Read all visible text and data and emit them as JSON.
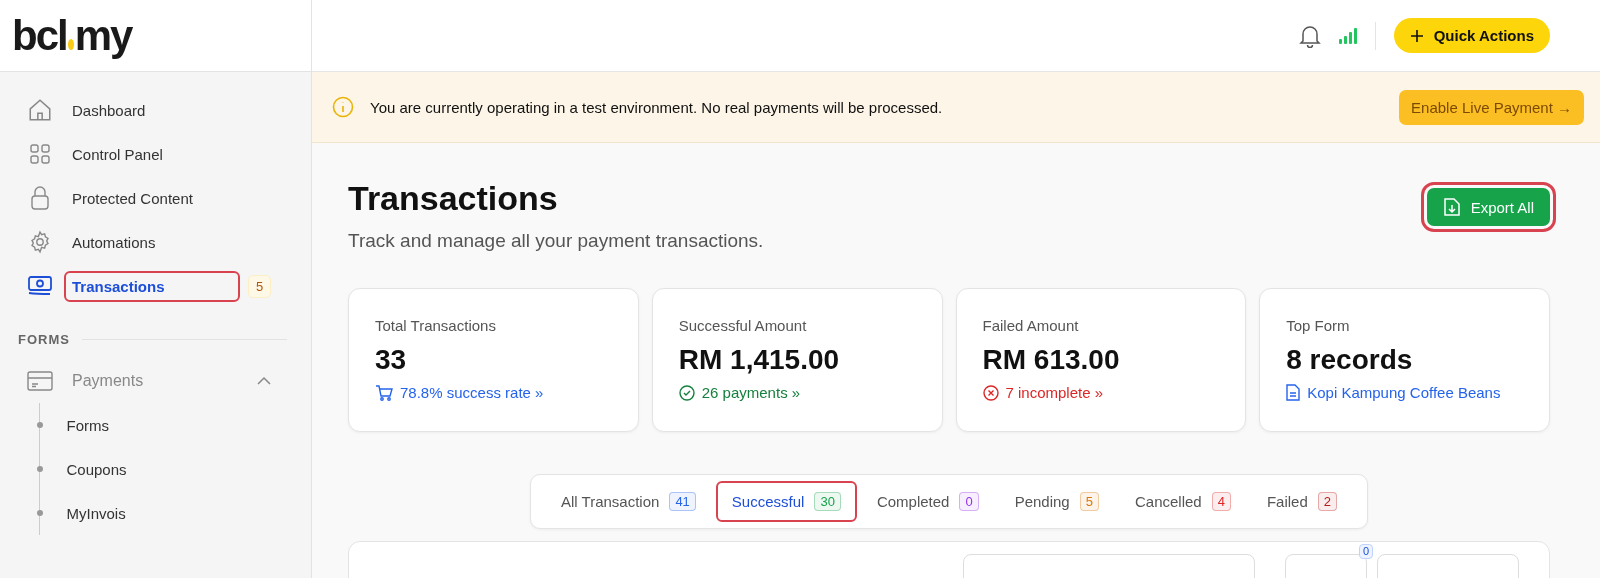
{
  "logo": {
    "left": "bcl",
    "right": "my"
  },
  "sidebar": {
    "items": [
      {
        "label": "Dashboard",
        "selected": false,
        "highlighted": false
      },
      {
        "label": "Control Panel",
        "selected": false,
        "highlighted": false
      },
      {
        "label": "Protected Content",
        "selected": false,
        "highlighted": false
      },
      {
        "label": "Automations",
        "selected": false,
        "highlighted": false
      },
      {
        "label": "Transactions",
        "selected": true,
        "highlighted": true,
        "badge": "5"
      }
    ],
    "section": "FORMS",
    "group": {
      "label": "Payments",
      "expanded": true,
      "children": [
        {
          "label": "Forms"
        },
        {
          "label": "Coupons"
        },
        {
          "label": "MyInvois"
        }
      ]
    }
  },
  "header": {
    "quick_actions": "Quick Actions"
  },
  "banner": {
    "text": "You are currently operating in a test environment. No real payments will be processed.",
    "button": "Enable Live Payment →"
  },
  "page": {
    "title": "Transactions",
    "subtitle": "Track and manage all your payment transactions.",
    "export": {
      "label": "Export All",
      "highlighted": true
    }
  },
  "stats": [
    {
      "label": "Total Transactions",
      "value": "33",
      "link": "78.8% success rate »",
      "kind": "cart"
    },
    {
      "label": "Successful Amount",
      "value": "RM 1,415.00",
      "link": "26 payments »",
      "kind": "success"
    },
    {
      "label": "Failed Amount",
      "value": "RM 613.00",
      "link": "7 incomplete »",
      "kind": "failed"
    },
    {
      "label": "Top Form",
      "value": "8 records",
      "link": "Kopi Kampung Coffee Beans",
      "kind": "document"
    }
  ],
  "tabs": [
    {
      "label": "All Transaction",
      "count": "41",
      "color": "#2563eb",
      "selected": false,
      "highlighted": false
    },
    {
      "label": "Successful",
      "count": "30",
      "color": "#16a34a",
      "selected": true,
      "highlighted": true
    },
    {
      "label": "Completed",
      "count": "0",
      "color": "#9333ea",
      "selected": false,
      "highlighted": false
    },
    {
      "label": "Pending",
      "count": "5",
      "color": "#d97706",
      "selected": false,
      "highlighted": false
    },
    {
      "label": "Cancelled",
      "count": "4",
      "color": "#dc2626",
      "selected": false,
      "highlighted": false
    },
    {
      "label": "Failed",
      "count": "2",
      "color": "#b91c1c",
      "selected": false,
      "highlighted": false
    }
  ],
  "filter_count": "0"
}
